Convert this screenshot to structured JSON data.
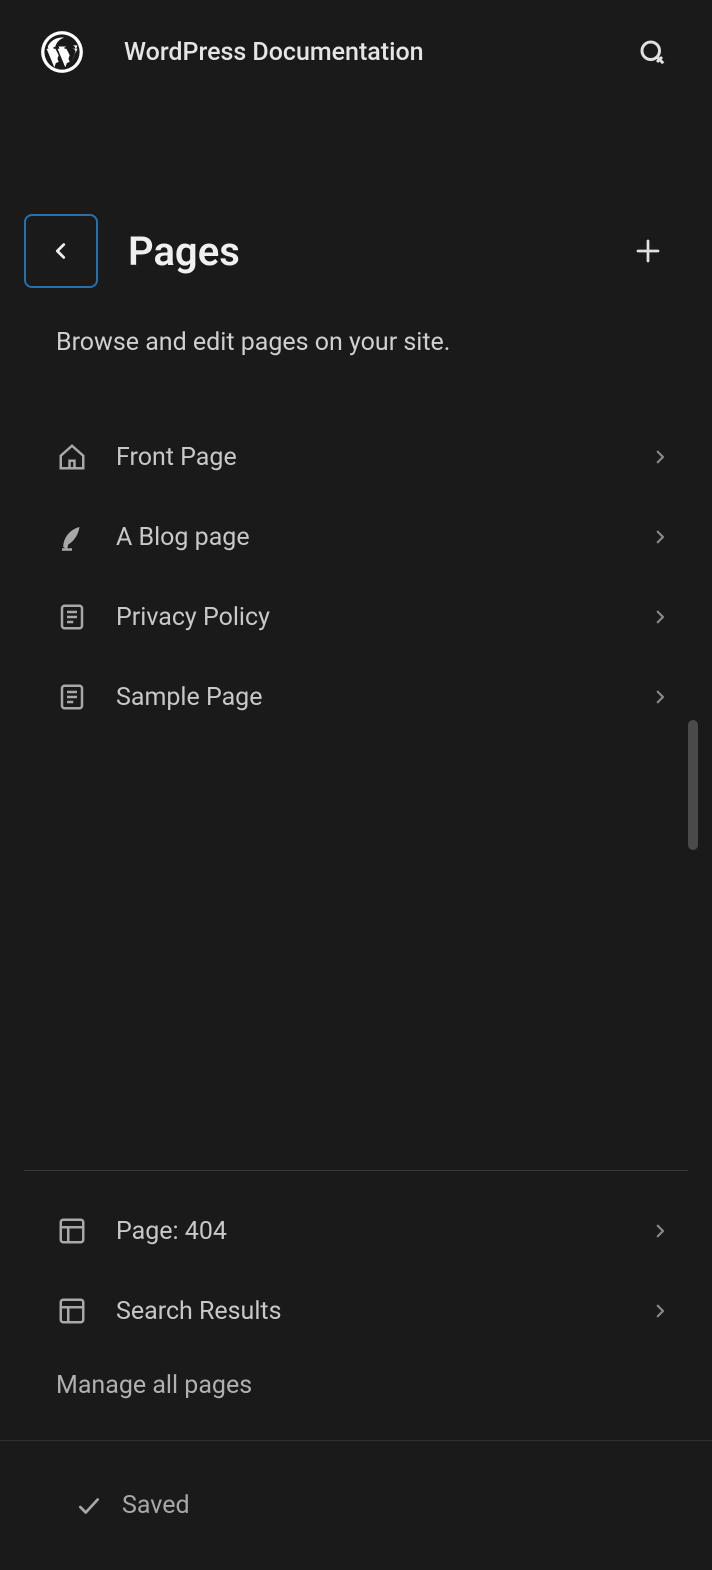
{
  "header": {
    "site_title": "WordPress Documentation"
  },
  "pages": {
    "title": "Pages",
    "description": "Browse and edit pages on your site.",
    "items": [
      {
        "icon": "home",
        "label": "Front Page"
      },
      {
        "icon": "quill",
        "label": "A Blog page"
      },
      {
        "icon": "page",
        "label": "Privacy Policy"
      },
      {
        "icon": "page",
        "label": "Sample Page"
      }
    ],
    "templates": [
      {
        "icon": "layout",
        "label": "Page: 404"
      },
      {
        "icon": "layout",
        "label": "Search Results"
      }
    ],
    "manage_label": "Manage all pages"
  },
  "footer": {
    "status": "Saved"
  }
}
